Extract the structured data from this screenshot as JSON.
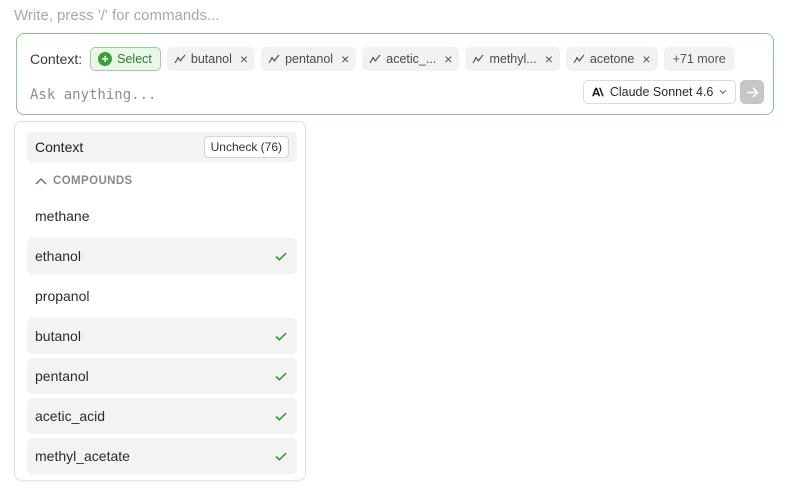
{
  "editor": {
    "placeholder": "Write, press '/' for commands..."
  },
  "composer": {
    "context_label": "Context:",
    "select_label": "Select",
    "chips": [
      {
        "label": "butanol",
        "icon": "trend-icon"
      },
      {
        "label": "pentanol",
        "icon": "trend-icon"
      },
      {
        "label": "acetic_...",
        "icon": "trend-icon"
      },
      {
        "label": "methyl...",
        "icon": "trend-icon"
      },
      {
        "label": "acetone",
        "icon": "trend-icon"
      }
    ],
    "more_label": "+71 more",
    "input_placeholder": "Ask anything...",
    "input_value": "",
    "model_name": "Claude Sonnet 4.6",
    "accent_color": "#8fc789"
  },
  "dropdown": {
    "title": "Context",
    "uncheck_label": "Uncheck (76)",
    "section_label": "COMPOUNDS",
    "items": [
      {
        "label": "methane",
        "checked": false
      },
      {
        "label": "ethanol",
        "checked": true
      },
      {
        "label": "propanol",
        "checked": false
      },
      {
        "label": "butanol",
        "checked": true
      },
      {
        "label": "pentanol",
        "checked": true
      },
      {
        "label": "acetic_acid",
        "checked": true
      },
      {
        "label": "methyl_acetate",
        "checked": true
      }
    ],
    "check_color": "#3a9a3a"
  }
}
